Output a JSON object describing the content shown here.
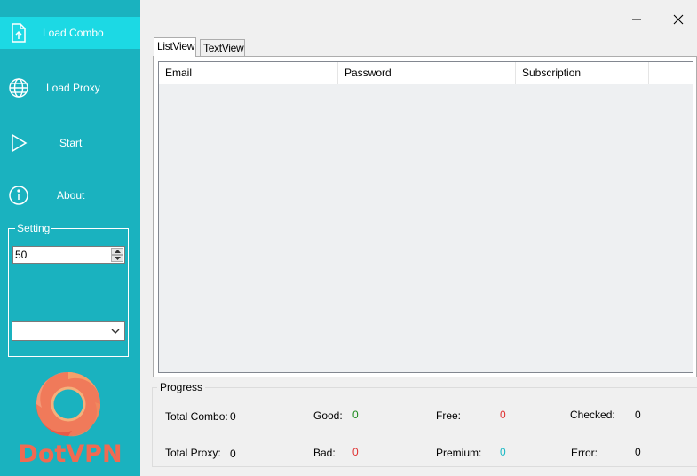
{
  "sidebar": {
    "items": [
      {
        "label": "Load Combo",
        "icon": "file-upload-icon"
      },
      {
        "label": "Load Proxy",
        "icon": "globe-icon"
      },
      {
        "label": "Start",
        "icon": "play-icon"
      },
      {
        "label": "About",
        "icon": "info-icon"
      }
    ],
    "settings": {
      "legend": "Setting",
      "threads_value": "50",
      "dropdown_value": ""
    },
    "brand": "DotVPN"
  },
  "tabs": [
    {
      "label": "ListView",
      "active": true
    },
    {
      "label": "TextView",
      "active": false
    }
  ],
  "list": {
    "columns": [
      "Email",
      "Password",
      "Subscription",
      ""
    ],
    "rows": []
  },
  "progress": {
    "legend": "Progress",
    "stats": {
      "total_combo": {
        "label": "Total Combo:",
        "value": "0"
      },
      "total_proxy": {
        "label": "Total Proxy:",
        "value": "0"
      },
      "good": {
        "label": "Good:",
        "value": "0"
      },
      "bad": {
        "label": "Bad:",
        "value": "0"
      },
      "free": {
        "label": "Free:",
        "value": "0"
      },
      "premium": {
        "label": "Premium:",
        "value": "0"
      },
      "checked": {
        "label": "Checked:",
        "value": "0"
      },
      "error": {
        "label": "Error:",
        "value": "0"
      }
    }
  },
  "colors": {
    "sidebar": "#1ab2bf",
    "sidebar_active": "#1cd9e4",
    "good": "#1a8a1a",
    "bad": "#e03030",
    "free": "#e03030",
    "premium": "#17b8c4",
    "brand": "#f06a52"
  }
}
